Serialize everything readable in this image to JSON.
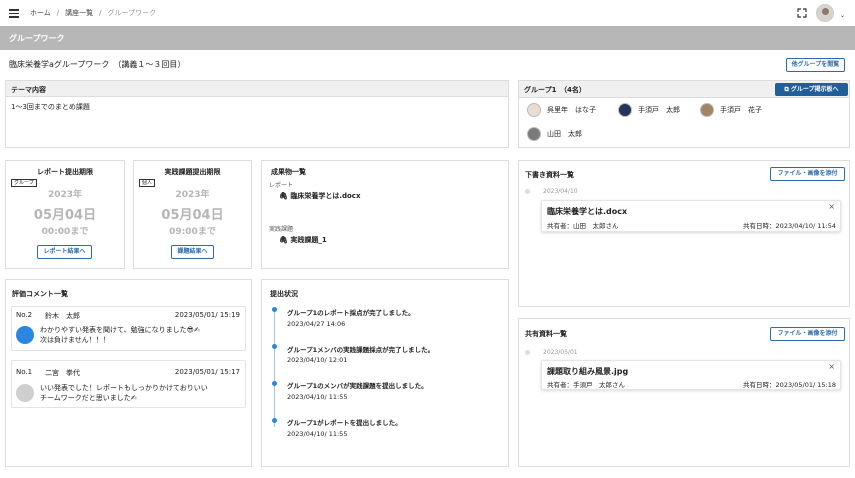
{
  "breadcrumb": {
    "home": "ホーム",
    "courses": "講座一覧",
    "current": "グループワーク",
    "sep": "/"
  },
  "page_title": "グループワーク",
  "course_title": "臨床栄養学aグループワーク　（講義１～３回目）",
  "other_groups_button": "他グループを閲覧",
  "theme": {
    "header": "テーマ内容",
    "body": "1～3回までのまとめ課題"
  },
  "group": {
    "header": "グループ1　（4名）",
    "board_button": "グループ掲示板へ",
    "members": [
      "呉里年　はな子",
      "手須戸　太郎",
      "手須戸　花子",
      "山田　太郎"
    ]
  },
  "report_deadline": {
    "title": "レポート提出期限",
    "tag": "グループ",
    "year": "2023年",
    "date": "05月04日",
    "time": "00:00まで",
    "button": "レポート結果へ"
  },
  "practice_deadline": {
    "title": "実践課題提出期限",
    "tag": "個人",
    "year": "2023年",
    "date": "05月04日",
    "time": "09:00まで",
    "button": "課題結果へ"
  },
  "deliverables": {
    "title": "成果物一覧",
    "report_label": "レポート",
    "report_file": "臨床栄養学とは.docx",
    "practice_label": "実践課題",
    "practice_file": "実践課題_1"
  },
  "comments": {
    "title": "評価コメント一覧",
    "items": [
      {
        "no": "No.2",
        "name": "鈴木　太郎",
        "date": "2023/05/01/ 15:19",
        "line1": "わかりやすい発表を聞けて、勉強になりました😎✍",
        "line2": "次は負けません！！！"
      },
      {
        "no": "No.1",
        "name": "二宮　拳代",
        "date": "2023/05/01/ 15:17",
        "line1": "いい発表でした！レポートもしっかりかけておりいい",
        "line2": "チームワークだと思いました✍"
      }
    ]
  },
  "status": {
    "title": "提出状況",
    "items": [
      {
        "text": "グループ1のレポート採点が完了しました。",
        "date": "2023/04/27 14:06"
      },
      {
        "text": "グループ1メンバの実践課題採点が完了しました。",
        "date": "2023/04/10/ 12:01"
      },
      {
        "text": "グループ1のメンバが実践課題を提出しました。",
        "date": "2023/04/10/ 11:55"
      },
      {
        "text": "グループ1がレポートを提出しました。",
        "date": "2023/04/10/ 11:55"
      }
    ]
  },
  "drafts": {
    "title": "下書き資料一覧",
    "add_button": "ファイル・画像を添付",
    "date": "2023/04/10",
    "file": "臨床栄養学とは.docx",
    "sharer": "共有者：山田　太郎さん",
    "shared_at": "共有日時：2023/04/10/ 11:54"
  },
  "shared": {
    "title": "共有資料一覧",
    "add_button": "ファイル・画像を添付",
    "date": "2023/05/01",
    "file": "課題取り組み風景.jpg",
    "sharer": "共有者：手須戸　太郎さん",
    "shared_at": "共有日時：2023/05/01/ 15:18"
  },
  "icons": {
    "close": "×",
    "caret": "⌄"
  },
  "colors": {
    "accent": "#215f9a",
    "timeline": "#2a86e0",
    "header_bar": "#b7b7b7"
  }
}
